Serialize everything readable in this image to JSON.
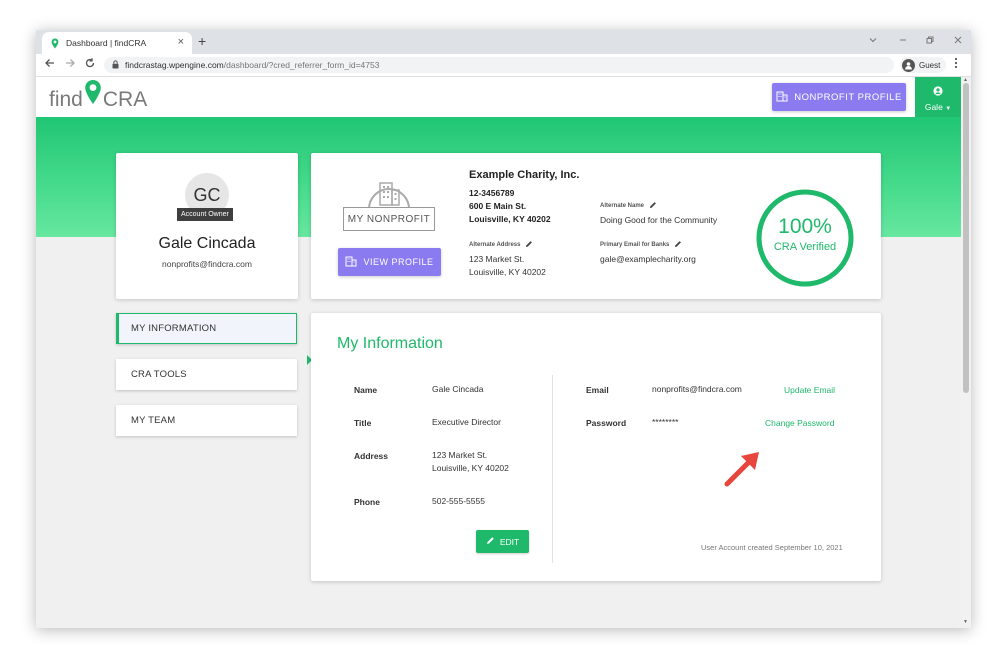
{
  "browser": {
    "tab_title": "Dashboard | findCRA",
    "new_tab": "+",
    "url_host": "findcrastag.wpengine.com",
    "url_path": "/dashboard/?cred_referrer_form_id=4753",
    "profile_label": "Guest",
    "profile_icon": "person-icon"
  },
  "site": {
    "logo_left": "find",
    "logo_right": "CRA",
    "nonprofit_profile_button": "NONPROFIT PROFILE",
    "user_menu_label": "Gale"
  },
  "profile": {
    "initials": "GC",
    "role_badge": "Account Owner",
    "name": "Gale Cincada",
    "email": "nonprofits@findcra.com"
  },
  "nonprofit": {
    "logo_text": "MY NONPROFIT",
    "view_profile_button": "VIEW PROFILE",
    "name": "Example Charity, Inc.",
    "ein": "12-3456789",
    "address_line1": "600 E Main St.",
    "address_line2": "Louisville, KY 40202",
    "alt_name_label": "Alternate Name",
    "alt_name": "Doing Good for the Community",
    "alt_address_label": "Alternate Address",
    "alt_address_line1": "123 Market St.",
    "alt_address_line2": "Louisville, KY 40202",
    "bank_email_label": "Primary Email for Banks",
    "bank_email": "gale@examplecharity.org",
    "verified_percent": "100%",
    "verified_fraction": 1.0,
    "verified_label": "CRA Verified"
  },
  "sidebar": {
    "items": [
      {
        "label": "MY INFORMATION",
        "active": true
      },
      {
        "label": "CRA TOOLS",
        "active": false
      },
      {
        "label": "MY TEAM",
        "active": false
      }
    ]
  },
  "info": {
    "title": "My Information",
    "name_label": "Name",
    "name_value": "Gale Cincada",
    "title_label": "Title",
    "title_value": "Executive Director",
    "address_label": "Address",
    "address_line1": "123 Market St.",
    "address_line2": "Louisville, KY 40202",
    "phone_label": "Phone",
    "phone_value": "502-555-5555",
    "edit_button": "EDIT",
    "email_label": "Email",
    "email_value": "nonprofits@findcra.com",
    "update_email_link": "Update Email",
    "password_label": "Password",
    "password_value": "********",
    "change_password_link": "Change Password",
    "created_text": "User Account created September 10, 2021"
  },
  "colors": {
    "brand_green": "#1fb96b",
    "accent_purple": "#8a7bf0",
    "annotation_red": "#e8453c"
  }
}
